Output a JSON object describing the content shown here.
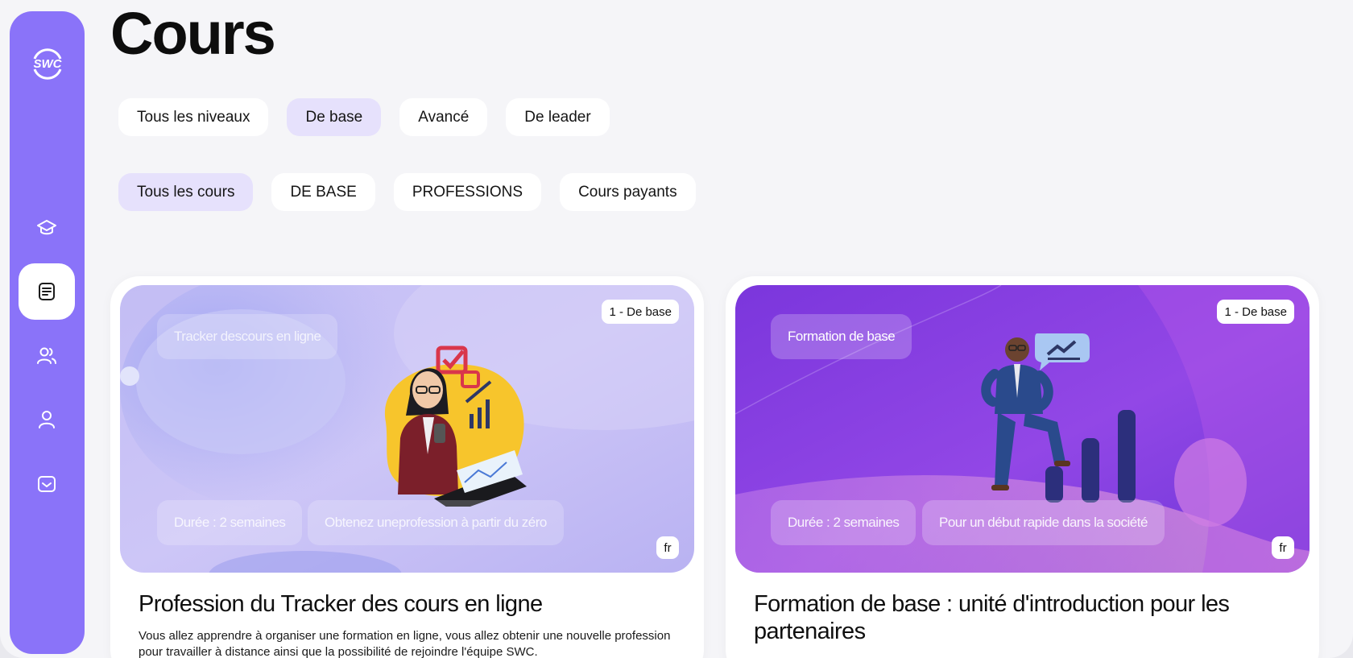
{
  "sidebar": {
    "logo_text": "SWC",
    "items": [
      {
        "icon": "graduation-cap-icon",
        "active": false
      },
      {
        "icon": "book-icon",
        "active": true
      },
      {
        "icon": "users-icon",
        "active": false
      },
      {
        "icon": "user-icon",
        "active": false
      },
      {
        "icon": "inbox-icon",
        "active": false
      }
    ]
  },
  "page": {
    "title": "Cours"
  },
  "level_filters": [
    {
      "label": "Tous les niveaux",
      "selected": false
    },
    {
      "label": "De base",
      "selected": true
    },
    {
      "label": "Avancé",
      "selected": false
    },
    {
      "label": "De leader",
      "selected": false
    }
  ],
  "category_filters": [
    {
      "label": "Tous les cours",
      "selected": true
    },
    {
      "label": "DE BASE",
      "selected": false
    },
    {
      "label": "PROFESSIONS",
      "selected": false
    },
    {
      "label": "Cours payants",
      "selected": false
    }
  ],
  "courses": [
    {
      "level": "1 - De base",
      "lang": "fr",
      "banner_tag": "Tracker descours en ligne",
      "duration": "Durée : 2 semaines",
      "subtitle": "Obtenez uneprofession à partir du zéro",
      "title": "Profession du Tracker des cours en ligne",
      "description": "Vous allez apprendre à organiser une formation en ligne, vous allez obtenir une nouvelle profession pour travailler à distance ainsi que la possibilité de rejoindre l'équipe SWC."
    },
    {
      "level": "1 - De base",
      "lang": "fr",
      "banner_tag": "Formation de base",
      "duration": "Durée : 2 semaines",
      "subtitle": "Pour un début rapide dans la société",
      "title": "Formation de base : unité d'introduction pour les partenaires",
      "description": ""
    }
  ],
  "colors": {
    "sidebar": "#8a73f9",
    "pill_selected": "#e6e1fc",
    "card1_banner": "#c9c2f5",
    "card2_banner": "#8b3fe0"
  }
}
